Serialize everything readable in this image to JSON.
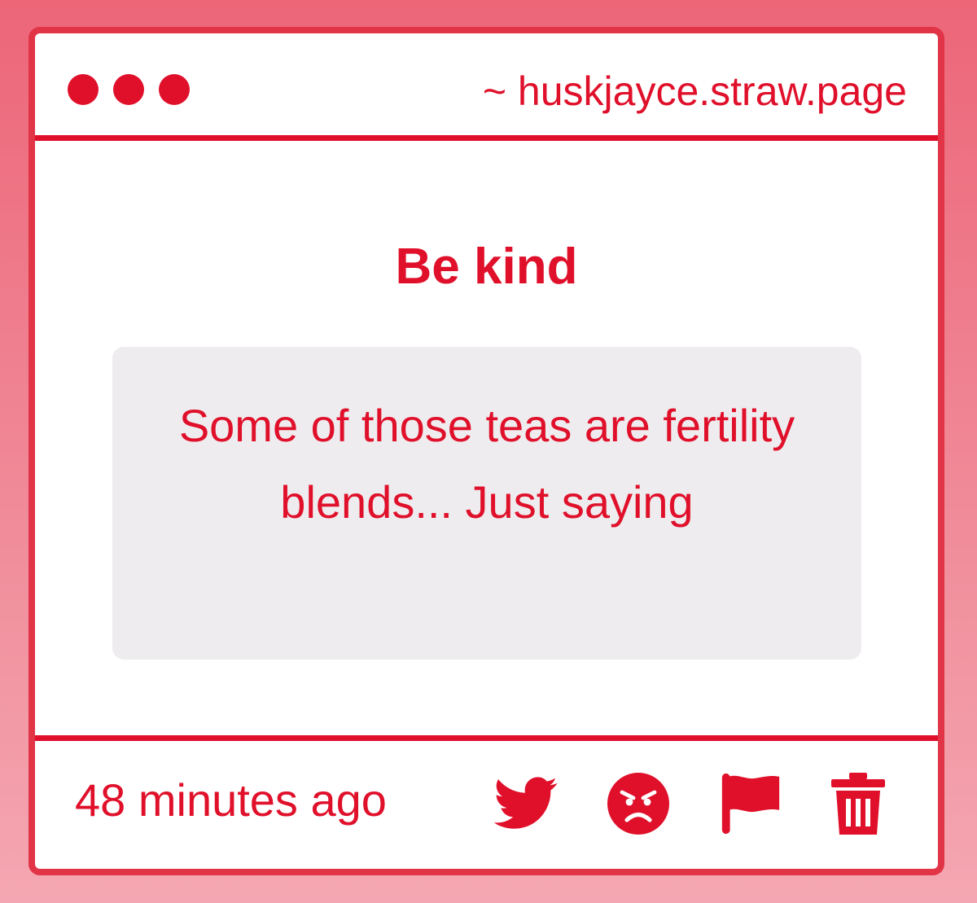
{
  "header": {
    "url": "~ huskjayce.straw.page"
  },
  "post": {
    "title": "Be kind",
    "message": "Some of those teas are fertility blends... Just saying"
  },
  "footer": {
    "timestamp": "48 minutes ago",
    "actions": [
      {
        "icon": "twitter-icon"
      },
      {
        "icon": "angry-face-icon"
      },
      {
        "icon": "flag-icon"
      },
      {
        "icon": "trash-icon"
      }
    ]
  },
  "colors": {
    "accent": "#e0102b",
    "border": "#e23447",
    "message_bg": "#eeecee",
    "background_top": "#ec6678",
    "background_bottom": "#f4a7b2"
  }
}
